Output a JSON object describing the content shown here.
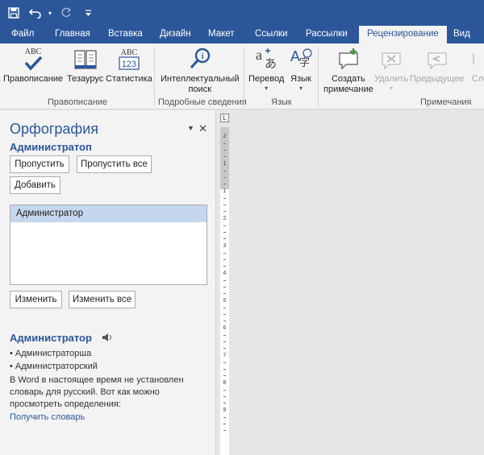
{
  "quick_access": {
    "save_icon": "save-icon",
    "undo_icon": "undo-icon",
    "redo_icon": "redo-icon",
    "customize_icon": "customize-icon"
  },
  "tabs": [
    "Файл",
    "Главная",
    "Вставка",
    "Дизайн",
    "Макет",
    "Ссылки",
    "Рассылки",
    "Рецензирование",
    "Вид"
  ],
  "ribbon": {
    "spelling": "Правописание",
    "thesaurus": "Тезаурус",
    "statistics": "Статистика",
    "smart_lookup_line1": "Интеллектуальный",
    "smart_lookup_line2": "поиск",
    "translate": "Перевод",
    "language": "Язык",
    "new_comment_line1": "Создать",
    "new_comment_line2": "примечание",
    "delete": "Удалить",
    "previous": "Предыдущее",
    "next": "Сле",
    "group_proofing": "Правописание",
    "group_insights": "Подробные сведения",
    "group_language": "Язык",
    "group_comments": "Примечания",
    "abc_label": "ABC",
    "abc123_label_top": "ABC",
    "abc123_label_bottom": "123"
  },
  "pane": {
    "title": "Орфография",
    "misspelled_word": "Администратоп",
    "ignore_button": "Пропустить",
    "ignore_all_button": "Пропустить все",
    "add_button": "Добавить",
    "suggestions": [
      "Администратор"
    ],
    "change_button": "Изменить",
    "change_all_button": "Изменить все",
    "definition_word": "Администратор",
    "synonyms": [
      "• Администраторша",
      "• Администраторский"
    ],
    "note": "В Word в настоящее время не установлен словарь для русский. Вот как можно просмотреть определения:",
    "get_dictionary_link": "Получить словарь"
  },
  "ruler": {
    "corner_mark": "L",
    "numbers": [
      "2",
      "1",
      "1",
      "2",
      "3",
      "4",
      "5",
      "6",
      "7",
      "8",
      "9"
    ]
  },
  "colors": {
    "brand": "#2b579a",
    "ribbon_bg": "#f3f3f3",
    "selection": "#c5d7ee"
  }
}
